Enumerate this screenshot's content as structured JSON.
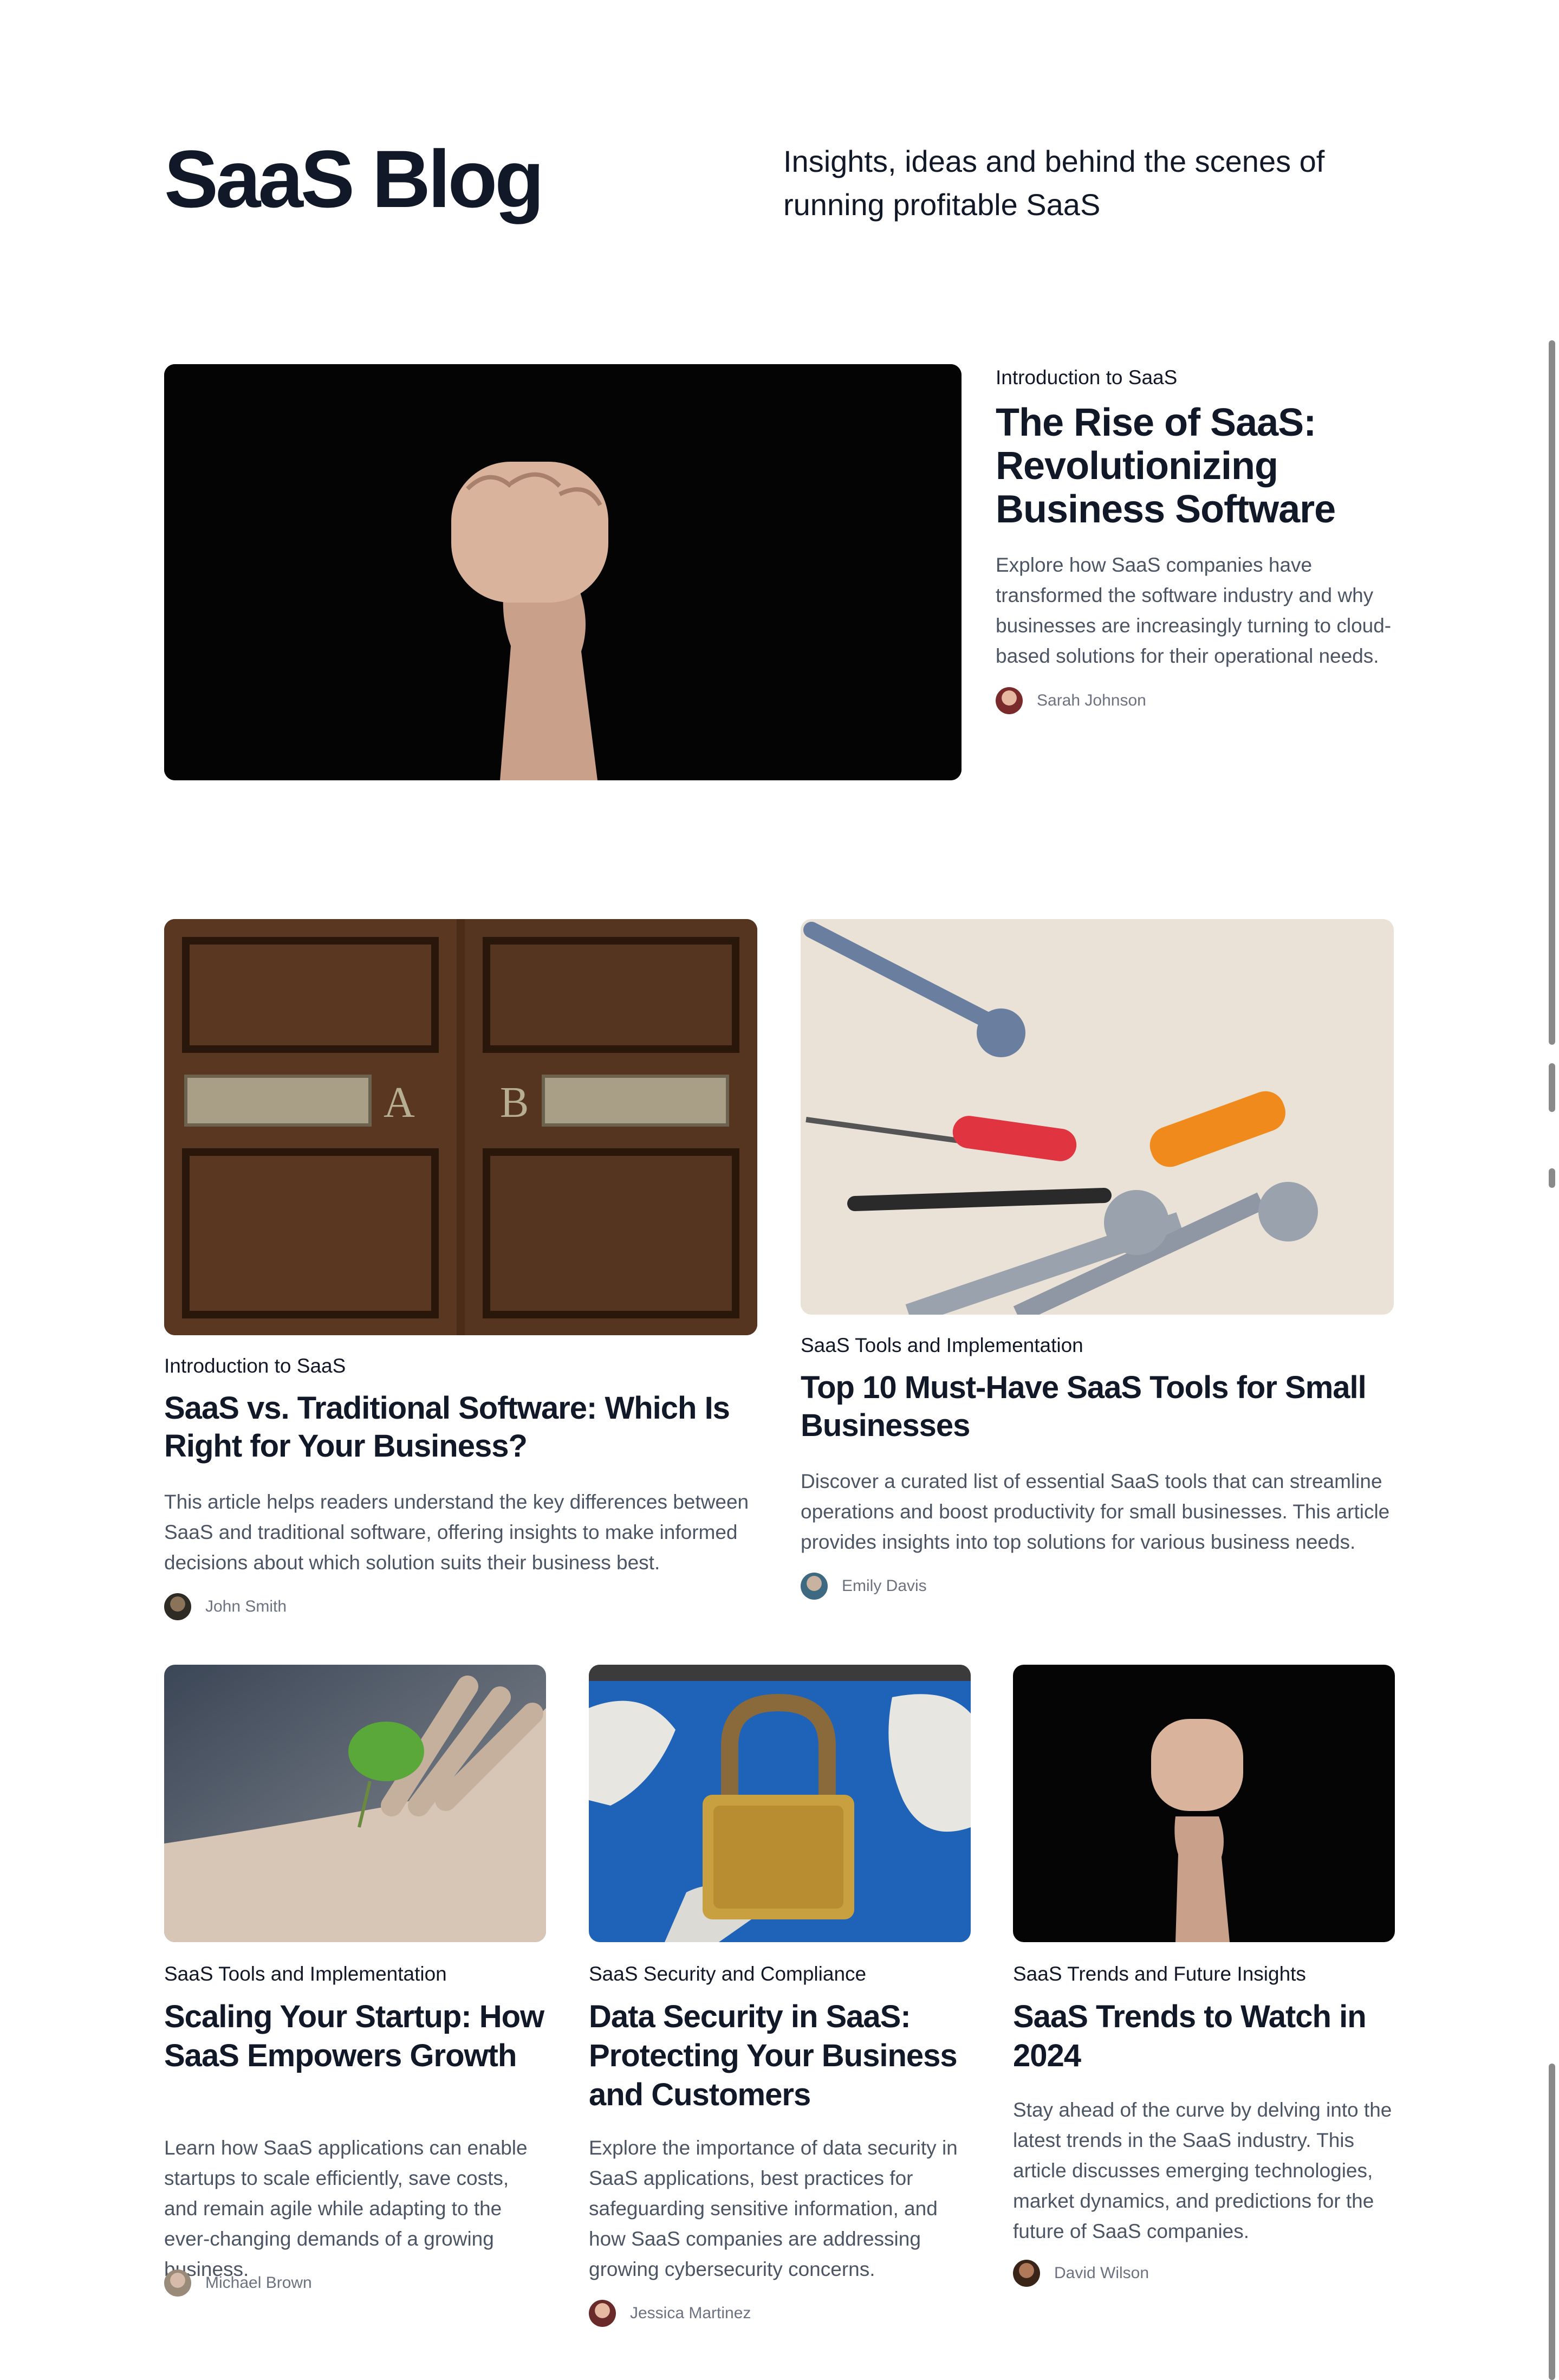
{
  "header": {
    "title": "SaaS Blog",
    "tagline": "Insights, ideas and behind the scenes of running profitable SaaS"
  },
  "featured": {
    "category": "Introduction to SaaS",
    "title": "The Rise of SaaS: Revolutionizing Business Software",
    "excerpt": "Explore how SaaS companies have transformed the software industry and why businesses are increasingly turning to cloud-based solutions for their operational needs.",
    "author": "Sarah Johnson"
  },
  "posts": [
    {
      "category": "Introduction to SaaS",
      "title": "SaaS vs. Traditional Software: Which Is Right for Your Business?",
      "excerpt": "This article helps readers understand the key differences between SaaS and traditional software, offering insights to make informed decisions about which solution suits their business best.",
      "author": "John Smith"
    },
    {
      "category": "SaaS Tools and Implementation",
      "title": "Top 10 Must-Have SaaS Tools for Small Businesses",
      "excerpt": "Discover a curated list of essential SaaS tools that can streamline operations and boost productivity for small businesses. This article provides insights into top solutions for various business needs.",
      "author": "Emily Davis"
    },
    {
      "category": "SaaS Tools and Implementation",
      "title": "Scaling Your Startup: How SaaS Empowers Growth",
      "excerpt": "Learn how SaaS applications can enable startups to scale efficiently, save costs, and remain agile while adapting to the ever-changing demands of a growing business.",
      "author": "Michael Brown"
    },
    {
      "category": "SaaS Security and Compliance",
      "title": "Data Security in SaaS: Protecting Your Business and Customers",
      "excerpt": "Explore the importance of data security in SaaS applications, best practices for safeguarding sensitive information, and how SaaS companies are addressing growing cybersecurity concerns.",
      "author": "Jessica Martinez"
    },
    {
      "category": "SaaS Trends and Future Insights",
      "title": "SaaS Trends to Watch in 2024",
      "excerpt": "Stay ahead of the curve by delving into the latest trends in the SaaS industry. This article discusses emerging technologies, market dynamics, and predictions for the future of SaaS companies.",
      "author": "David Wilson"
    }
  ],
  "images": {
    "featured": "raised-fist-photo",
    "post_0": "wooden-doors-photo",
    "post_1": "tools-photo",
    "post_2": "seedling-hand-photo",
    "post_3": "padlock-photo",
    "post_4": "raised-fist-photo"
  }
}
